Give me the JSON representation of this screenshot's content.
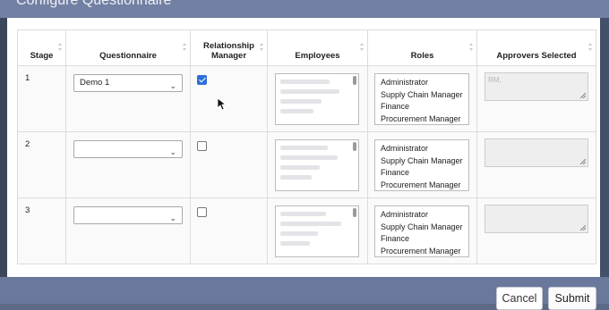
{
  "dialog": {
    "title": "Configure Questionnaire",
    "cancel_label": "Cancel",
    "submit_label": "Submit"
  },
  "table": {
    "headers": {
      "stage": "Stage",
      "questionnaire": "Questionnaire",
      "relationship_manager": "Relationship Manager",
      "employees": "Employees",
      "roles": "Roles",
      "approvers_selected": "Approvers Selected"
    },
    "rows": [
      {
        "stage": "1",
        "questionnaire": "Demo 1",
        "relationship_manager_checked": true,
        "roles": [
          "Administrator",
          "Supply Chain Manager",
          "Finance",
          "Procurement Manager"
        ],
        "approvers": "RM,"
      },
      {
        "stage": "2",
        "questionnaire": "",
        "relationship_manager_checked": false,
        "roles": [
          "Administrator",
          "Supply Chain Manager",
          "Finance",
          "Procurement Manager"
        ],
        "approvers": ""
      },
      {
        "stage": "3",
        "questionnaire": "",
        "relationship_manager_checked": false,
        "roles": [
          "Administrator",
          "Supply Chain Manager",
          "Finance",
          "Procurement Manager"
        ],
        "approvers": ""
      }
    ]
  },
  "icons": {
    "dropdown": "chevron-down-icon",
    "sort": "sort-icon",
    "checkbox_checked": "checkbox-checked",
    "cursor": "mouse-pointer-icon"
  },
  "colors": {
    "header_bar": "#7280a3",
    "footer_bar": "#6a789c",
    "checkbox_accent": "#2f6fd6"
  }
}
